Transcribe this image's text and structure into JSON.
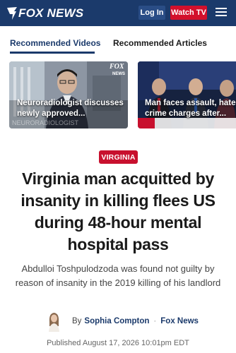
{
  "header": {
    "logo_text": "FOX NEWS",
    "login_label": "Log In",
    "watch_label": "Watch TV",
    "colors": {
      "bar": "#1b3a6b",
      "watch": "#d3102c"
    }
  },
  "tabs": [
    {
      "label": "Recommended Videos",
      "active": true
    },
    {
      "label": "Recommended Articles",
      "active": false
    }
  ],
  "cards": [
    {
      "caption_line1": "Neuroradiologist discusses",
      "caption_line2": "newly approved..."
    },
    {
      "caption_line1": "Man faces assault, hate",
      "caption_line2": "crime charges after..."
    }
  ],
  "article": {
    "label": "VIRGINIA",
    "headline": "Virginia man acquitted by insanity in killing flees US during 48-hour mental hospital pass",
    "dek": "Abdulloi Toshpulodzoda was found not guilty by reason of insanity in the 2019 killing of his landlord",
    "byline_prefix": "By",
    "author": "Sophia Compton",
    "source": "Fox News",
    "published": "Published August 17, 2026 10:01pm EDT"
  }
}
